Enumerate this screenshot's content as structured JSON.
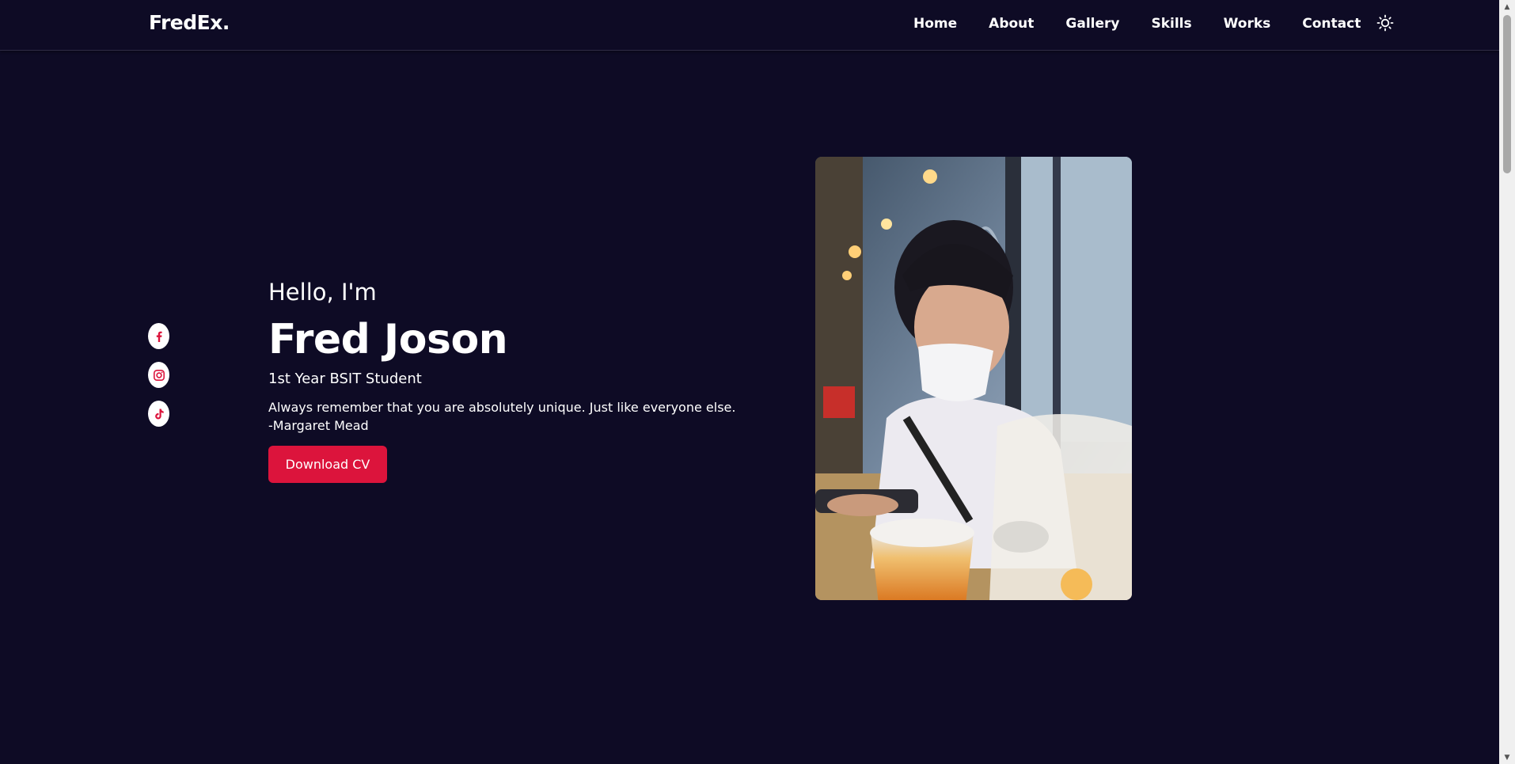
{
  "header": {
    "logo": "FredEx.",
    "nav": [
      {
        "label": "Home"
      },
      {
        "label": "About"
      },
      {
        "label": "Gallery"
      },
      {
        "label": "Skills"
      },
      {
        "label": "Works"
      },
      {
        "label": "Contact"
      }
    ],
    "theme_toggle_icon": "sun-icon"
  },
  "socials": [
    {
      "icon": "facebook-icon"
    },
    {
      "icon": "instagram-icon"
    },
    {
      "icon": "tiktok-icon"
    }
  ],
  "hero": {
    "greeting": "Hello, I'm",
    "name": "Fred Joson",
    "role": "1st Year BSIT Student",
    "quote": "Always remember that you are absolutely unique. Just like everyone else.",
    "quote_author": "-Margaret Mead",
    "cv_button": "Download CV"
  },
  "colors": {
    "background": "#0e0b25",
    "accent": "#dc143c",
    "text": "#ffffff"
  }
}
